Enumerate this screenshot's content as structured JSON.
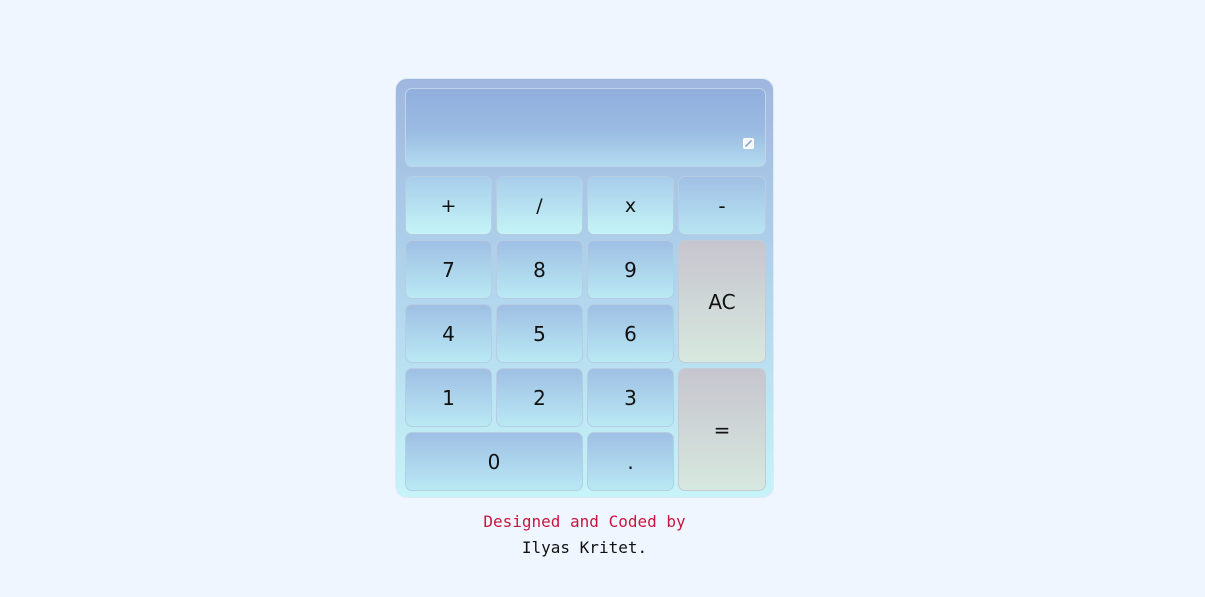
{
  "display": {
    "value": "",
    "resize_icon": "resize-handle-icon"
  },
  "operators": {
    "add": "+",
    "divide": "/",
    "multiply": "x",
    "subtract": "-"
  },
  "digits": {
    "seven": "7",
    "eight": "8",
    "nine": "9",
    "four": "4",
    "five": "5",
    "six": "6",
    "one": "1",
    "two": "2",
    "three": "3",
    "zero": "0",
    "decimal": "."
  },
  "actions": {
    "clear": "AC",
    "equals": "="
  },
  "credits": {
    "line1": "Designed and Coded by",
    "line2": "Ilyas Kritet."
  },
  "colors": {
    "page_background": "#eff6ff",
    "credits_accent": "#c8163f",
    "text": "#111111"
  }
}
